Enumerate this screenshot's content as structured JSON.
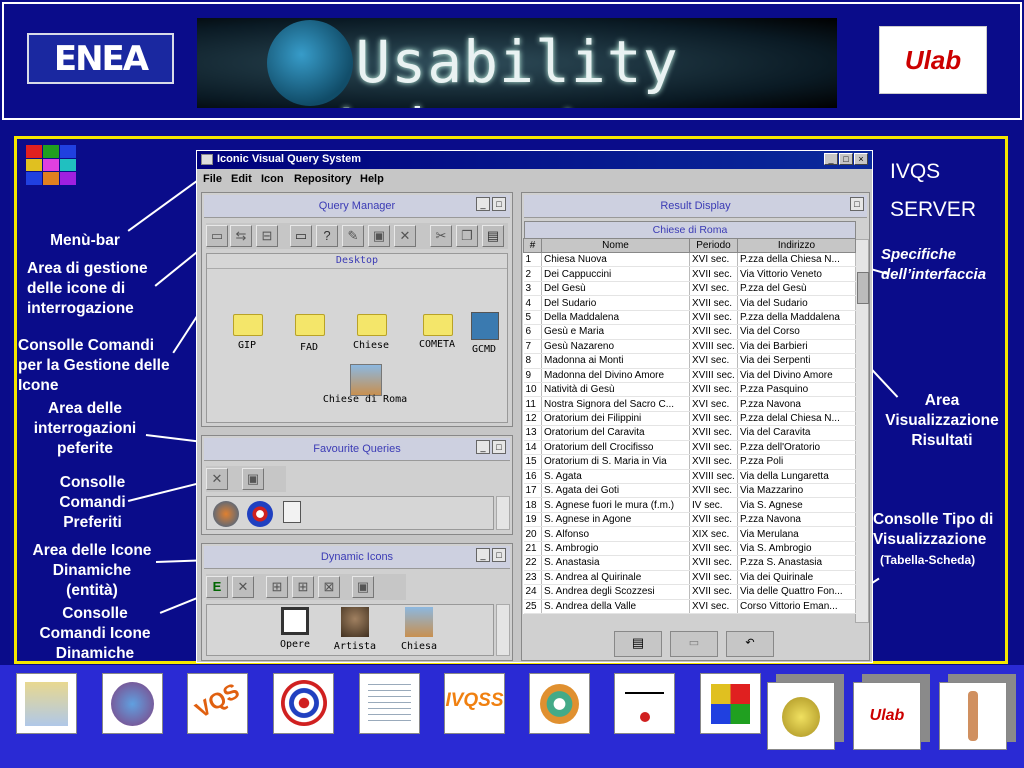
{
  "banner": {
    "enea_logo_text": "ENEA",
    "title": "Usability Laboratory",
    "ulab_logo_text": "Ulab"
  },
  "slide": {
    "server_title_line1": "IVQS",
    "server_title_line2": "SERVER",
    "spec_label_line1": "Specifiche",
    "spec_label_line2": "dell’interfaccia",
    "labels": {
      "menu_bar": "Menù-bar",
      "icon_area": [
        "Area di gestione",
        "delle icone di",
        "interrogazione"
      ],
      "command_console": [
        "Consolle Comandi",
        "per la Gestione delle",
        "Icone"
      ],
      "favourite_area": [
        "Area delle",
        "interrogazioni",
        "peferite"
      ],
      "favourite_console": [
        "Consolle",
        "Comandi",
        "Preferiti"
      ],
      "dynamic_area": [
        "Area delle Icone",
        "Dinamiche",
        "(entità)"
      ],
      "dynamic_console": [
        "Consolle",
        "Comandi Icone",
        "Dinamiche"
      ],
      "results_area": [
        "Area",
        "Visualizzazione",
        "Risultati"
      ],
      "view_type_console": [
        "Consolle Tipo di",
        "Visualizzazione"
      ],
      "view_type_sub": "(Tabella-Scheda)"
    }
  },
  "app": {
    "title": "Iconic Visual Query System",
    "menu": [
      "File",
      "Edit",
      "Icon",
      "Repository",
      "Help"
    ],
    "query_manager": {
      "title": "Query Manager",
      "desktop_label": "Desktop",
      "folders": [
        "GIP",
        "FAD",
        "Chiese",
        "COMETA",
        "GCMD"
      ],
      "extra_item": "Chiese di Roma"
    },
    "favourite_queries": {
      "title": "Favourite Queries"
    },
    "dynamic_icons": {
      "title": "Dynamic Icons",
      "items": [
        "Opere",
        "Artista",
        "Chiesa"
      ]
    },
    "result_display": {
      "title": "Result Display",
      "subtitle": "Chiese di Roma",
      "columns": [
        "#",
        "Nome",
        "Periodo",
        "Indirizzo"
      ],
      "rows": [
        [
          "1",
          "Chiesa Nuova",
          "XVI sec.",
          "P.zza della Chiesa N..."
        ],
        [
          "2",
          "Dei Cappuccini",
          "XVII sec.",
          "Via Vittorio Veneto"
        ],
        [
          "3",
          "Del Gesù",
          "XVI sec.",
          "P.zza del Gesù"
        ],
        [
          "4",
          "Del Sudario",
          "XVII sec.",
          "Via del Sudario"
        ],
        [
          "5",
          "Della Maddalena",
          "XVII sec.",
          "P.zza della Maddalena"
        ],
        [
          "6",
          "Gesù e Maria",
          "XVII sec.",
          "Via del Corso"
        ],
        [
          "7",
          "Gesù Nazareno",
          "XVIII sec.",
          "Via dei Barbieri"
        ],
        [
          "8",
          "Madonna ai Monti",
          "XVI sec.",
          "Via dei Serpenti"
        ],
        [
          "9",
          "Madonna del Divino Amore",
          "XVIII sec.",
          "Via del Divino Amore"
        ],
        [
          "10",
          "Natività di Gesù",
          "XVII sec.",
          "P.zza Pasquino"
        ],
        [
          "11",
          "Nostra Signora del Sacro C...",
          "XVI sec.",
          "P.zza Navona"
        ],
        [
          "12",
          "Oratorium dei Filippini",
          "XVII sec.",
          "P.zza delal Chiesa N..."
        ],
        [
          "13",
          "Oratorium del Caravita",
          "XVII sec.",
          "Via del Caravita"
        ],
        [
          "14",
          "Oratorium dell Crocifisso",
          "XVII sec.",
          "P.zza dell'Oratorio"
        ],
        [
          "15",
          "Oratorium di S. Maria in Via",
          "XVII sec.",
          "P.zza Poli"
        ],
        [
          "16",
          "S. Agata",
          "XVIII sec.",
          "Via della Lungaretta"
        ],
        [
          "17",
          "S. Agata dei Goti",
          "XVII sec.",
          "Via Mazzarino"
        ],
        [
          "18",
          "S. Agnese fuori le mura (f.m.)",
          "IV sec.",
          "Via S. Agnese"
        ],
        [
          "19",
          "S. Agnese in Agone",
          "XVII sec.",
          "P.zza Navona"
        ],
        [
          "20",
          "S. Alfonso",
          "XIX sec.",
          "Via Merulana"
        ],
        [
          "21",
          "S. Ambrogio",
          "XVII sec.",
          "Via S. Ambrogio"
        ],
        [
          "22",
          "S. Anastasia",
          "XVII sec.",
          "P.zza S. Anastasia"
        ],
        [
          "23",
          "S. Andrea al Quirinale",
          "XVII sec.",
          "Via dei Quirinale"
        ],
        [
          "24",
          "S. Andrea degli Scozzesi",
          "XVII sec.",
          "Via delle Quattro Fon..."
        ],
        [
          "25",
          "S. Andrea della Valle",
          "XVI sec.",
          "Corso Vittorio Eman..."
        ]
      ]
    }
  },
  "bottom_tiles": {
    "ivqss_label": "IVQSS",
    "vqs_label": "VQS",
    "ulab_label": "Ulab"
  },
  "colors": {
    "background_blue": "#0a0c8a",
    "frame_yellow": "#f5e600",
    "bottom_blue": "#2a2ad4"
  }
}
